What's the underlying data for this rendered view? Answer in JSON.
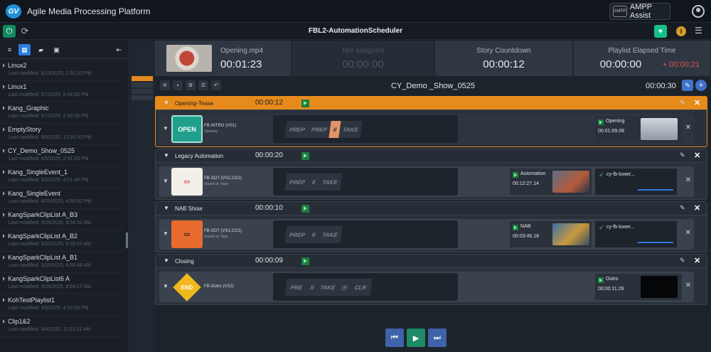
{
  "app": {
    "title": "Agile Media Processing Platform",
    "logo": "GV",
    "assist_label": "AMPP Assist",
    "assist_icon": "AMPP"
  },
  "toolbar": {
    "title": "FBL2-AutomationScheduler"
  },
  "sidebar": {
    "stories": [
      {
        "name": "Linux2",
        "modified": "Last modified: 5/13/2025, 2:51:20 PM"
      },
      {
        "name": "Linux1",
        "modified": "Last modified: 5/7/2025, 6:04:05 PM"
      },
      {
        "name": "Kang_Graphic",
        "modified": "Last modified: 5/7/2025, 2:58:08 PM"
      },
      {
        "name": "EmptyStory",
        "modified": "Last modified: 5/6/2025, 12:26:10 PM"
      },
      {
        "name": "CY_Demo_Show_0525",
        "modified": "Last modified: 5/5/2025, 2:51:33 PM"
      },
      {
        "name": "Kang_SingleEvent_1",
        "modified": "Last modified: 5/2/2025, 4:01:40 PM"
      },
      {
        "name": "Kang_SingleEvent",
        "modified": "Last modified: 4/29/2025, 4:55:02 PM"
      },
      {
        "name": "KangSparkClipList A_B3",
        "modified": "Last modified: 3/25/2025, 9:04:31 AM"
      },
      {
        "name": "KangSparkClipList A_B2",
        "modified": "Last modified: 3/25/2025, 9:03:15 AM"
      },
      {
        "name": "KangSparkClipList A_B1",
        "modified": "Last modified: 3/25/2025, 8:58:49 AM"
      },
      {
        "name": "KangSparkClipList6 A",
        "modified": "Last modified: 3/25/2025, 8:54:17 AM"
      },
      {
        "name": "KohTestPlaylist1",
        "modified": "Last modified: 3/6/2025, 4:53:59 PM"
      },
      {
        "name": "Clip1&2",
        "modified": "Last modified: 3/4/2025, 11:51:51 AM"
      }
    ]
  },
  "header": {
    "opening_label": "Opening.mp4",
    "opening_time": "00:01:23",
    "na_label": "Not assigned",
    "na_time": "00:00:00",
    "countdown_label": "Story Countdown",
    "countdown_time": "00:00:12",
    "elapsed_label": "Playlist Elapsed Time",
    "elapsed_time": "00:00:00",
    "elapsed_delta": "+ 00:00:21"
  },
  "show": {
    "name": "CY_Demo _Show_0525",
    "duration": "00:00:30"
  },
  "segments": [
    {
      "name": "Opening-Tease",
      "duration": "00:00:12",
      "event": {
        "icon": "OPEN",
        "name": "FB-INTRO (VS1)",
        "sub": "Opening",
        "btn1": "PREP",
        "btn2": "PREP",
        "btn3": "II",
        "btn4": "TAKE",
        "out_name": "Opening",
        "out_time": "00:01:09.08"
      }
    },
    {
      "name": "Legacy Automation",
      "duration": "00:00:20",
      "event": {
        "name": "FB-SOT (VS2,CG2)",
        "sub": "Sound on Tape",
        "btn1": "PREP",
        "btn2": "II",
        "btn3": "TAKE",
        "out_name": "Automation",
        "out_time": "00:12:27.14",
        "gfx": "cy-fb-lower..."
      }
    },
    {
      "name": "NAB Show",
      "duration": "00:00:10",
      "event": {
        "name": "FB-SOT (VS1,CG1)",
        "sub": "Sound on Tape",
        "btn1": "PREP",
        "btn2": "II",
        "btn3": "TAKE",
        "out_name": "NAB",
        "out_time": "00:03:45.18",
        "gfx": "cy-fb-lower..."
      }
    },
    {
      "name": "Closing",
      "duration": "00:00:09",
      "event": {
        "icon": "END",
        "name": "FB-Outro (VS2)",
        "btn1": "PRE",
        "btn2": "II",
        "btn3": "TAKE",
        "btn5": "CLR",
        "out_name": "Outro",
        "out_time": "00:00:11.26"
      }
    }
  ]
}
